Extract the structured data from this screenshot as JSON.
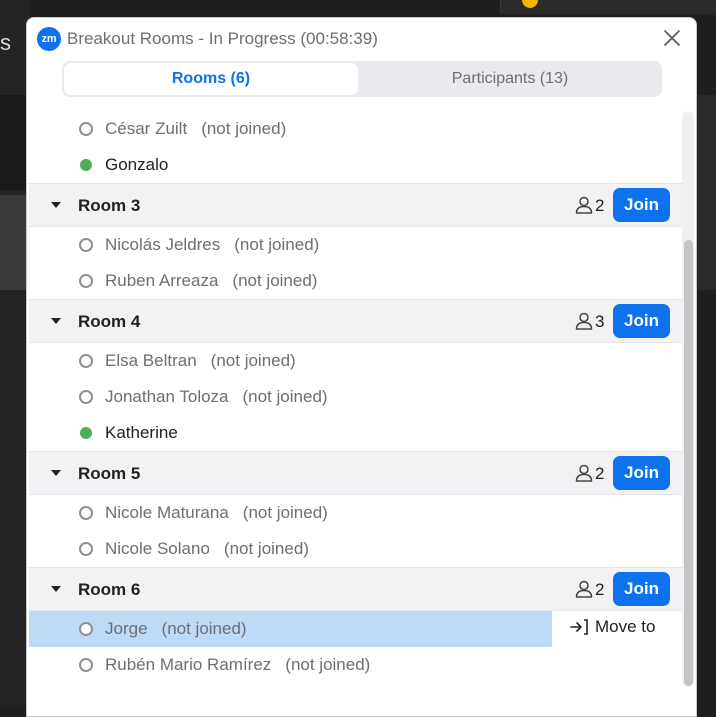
{
  "background": {
    "left_letter": "s"
  },
  "window": {
    "logo": "zm",
    "title": "Breakout Rooms - In Progress (00:58:39)"
  },
  "tabs": [
    {
      "label": "Rooms (6)",
      "active": true
    },
    {
      "label": "Participants (13)",
      "active": false
    }
  ],
  "status_not_joined": "(not joined)",
  "partial_room": {
    "participants": [
      {
        "name": "César Zuilt",
        "status": "(not joined)",
        "joined": false
      },
      {
        "name": "Gonzalo",
        "status": "",
        "joined": true
      }
    ]
  },
  "rooms": [
    {
      "name": "Room 3",
      "count": "2",
      "join_label": "Join",
      "participants": [
        {
          "name": "Nicolás Jeldres",
          "status": "(not joined)",
          "joined": false
        },
        {
          "name": "Ruben Arreaza",
          "status": "(not joined)",
          "joined": false
        }
      ]
    },
    {
      "name": "Room 4",
      "count": "3",
      "join_label": "Join",
      "participants": [
        {
          "name": "Elsa Beltran",
          "status": "(not joined)",
          "joined": false
        },
        {
          "name": "Jonathan Toloza",
          "status": "(not joined)",
          "joined": false
        },
        {
          "name": "Katherine",
          "status": "",
          "joined": true
        }
      ]
    },
    {
      "name": "Room 5",
      "count": "2",
      "join_label": "Join",
      "participants": [
        {
          "name": "Nicole Maturana",
          "status": "(not joined)",
          "joined": false
        },
        {
          "name": "Nicole Solano",
          "status": "(not joined)",
          "joined": false
        }
      ]
    },
    {
      "name": "Room 6",
      "count": "2",
      "join_label": "Join",
      "participants": [
        {
          "name": "Jorge",
          "status": "(not joined)",
          "joined": false,
          "selected": true,
          "action": "Move to"
        },
        {
          "name": "Rubén Mario Ramírez",
          "status": "(not joined)",
          "joined": false
        }
      ]
    }
  ],
  "colors": {
    "accent": "#0e72ed",
    "joined_dot": "#4cae5b",
    "selected_row": "#bfdaf7",
    "header_bg": "#f2f2f5"
  },
  "icons": [
    "zoom-logo",
    "close-icon",
    "caret-down-icon",
    "person-icon",
    "move-to-icon"
  ]
}
